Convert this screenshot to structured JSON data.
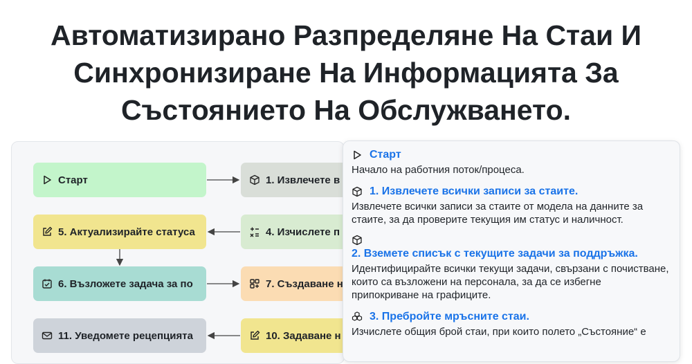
{
  "page": {
    "title": "Автоматизирано Разпределяне На Стаи И Синхронизиране На Информацията За Състоянието На Обслужването."
  },
  "diagram": {
    "nodes": [
      {
        "id": "start",
        "label": "Старт",
        "icon": "play-icon",
        "color": "#c3f5cb"
      },
      {
        "id": "n1",
        "label": "1. Извлечете в",
        "icon": "cube-icon",
        "color": "#d9ded8"
      },
      {
        "id": "n5",
        "label": "5. Актуализирайте статуса",
        "icon": "edit-icon",
        "color": "#f1e58f"
      },
      {
        "id": "n4",
        "label": "4. Изчислете п",
        "icon": "calculator-icon",
        "color": "#d8ebd1"
      },
      {
        "id": "n6",
        "label": "6. Възложете задача за по",
        "icon": "calendar-check-icon",
        "color": "#a8dcd3"
      },
      {
        "id": "n7",
        "label": "7. Създаване н",
        "icon": "grid-plus-icon",
        "color": "#fbdcb3"
      },
      {
        "id": "n11",
        "label": "11. Уведомете рецепцията",
        "icon": "mail-icon",
        "color": "#ced3da"
      },
      {
        "id": "n10",
        "label": "10. Задаване н",
        "icon": "edit-icon",
        "color": "#f1e58f"
      }
    ]
  },
  "details": {
    "steps": [
      {
        "icon": "play-icon",
        "title": "Старт",
        "description": "Начало на работния поток/процеса."
      },
      {
        "icon": "cube-icon",
        "title": "1. Извлечете всички записи за стаите.",
        "description": "Извлечете всички записи за стаите от модела на данните за стаите, за да проверите текущия им статус и наличност."
      },
      {
        "icon": "cube-icon",
        "title": "2. Вземете списък с текущите задачи за поддръжка.",
        "description": "Идентифицирайте всички текущи задачи, свързани с почистване, които са възложени на персонала, за да се избегне припокриване на графиците."
      },
      {
        "icon": "cubes-icon",
        "title": "3. Пребройте мръсните стаи.",
        "description": "Изчислете общия брой стаи, при които полето „Състояние“ е"
      }
    ]
  }
}
